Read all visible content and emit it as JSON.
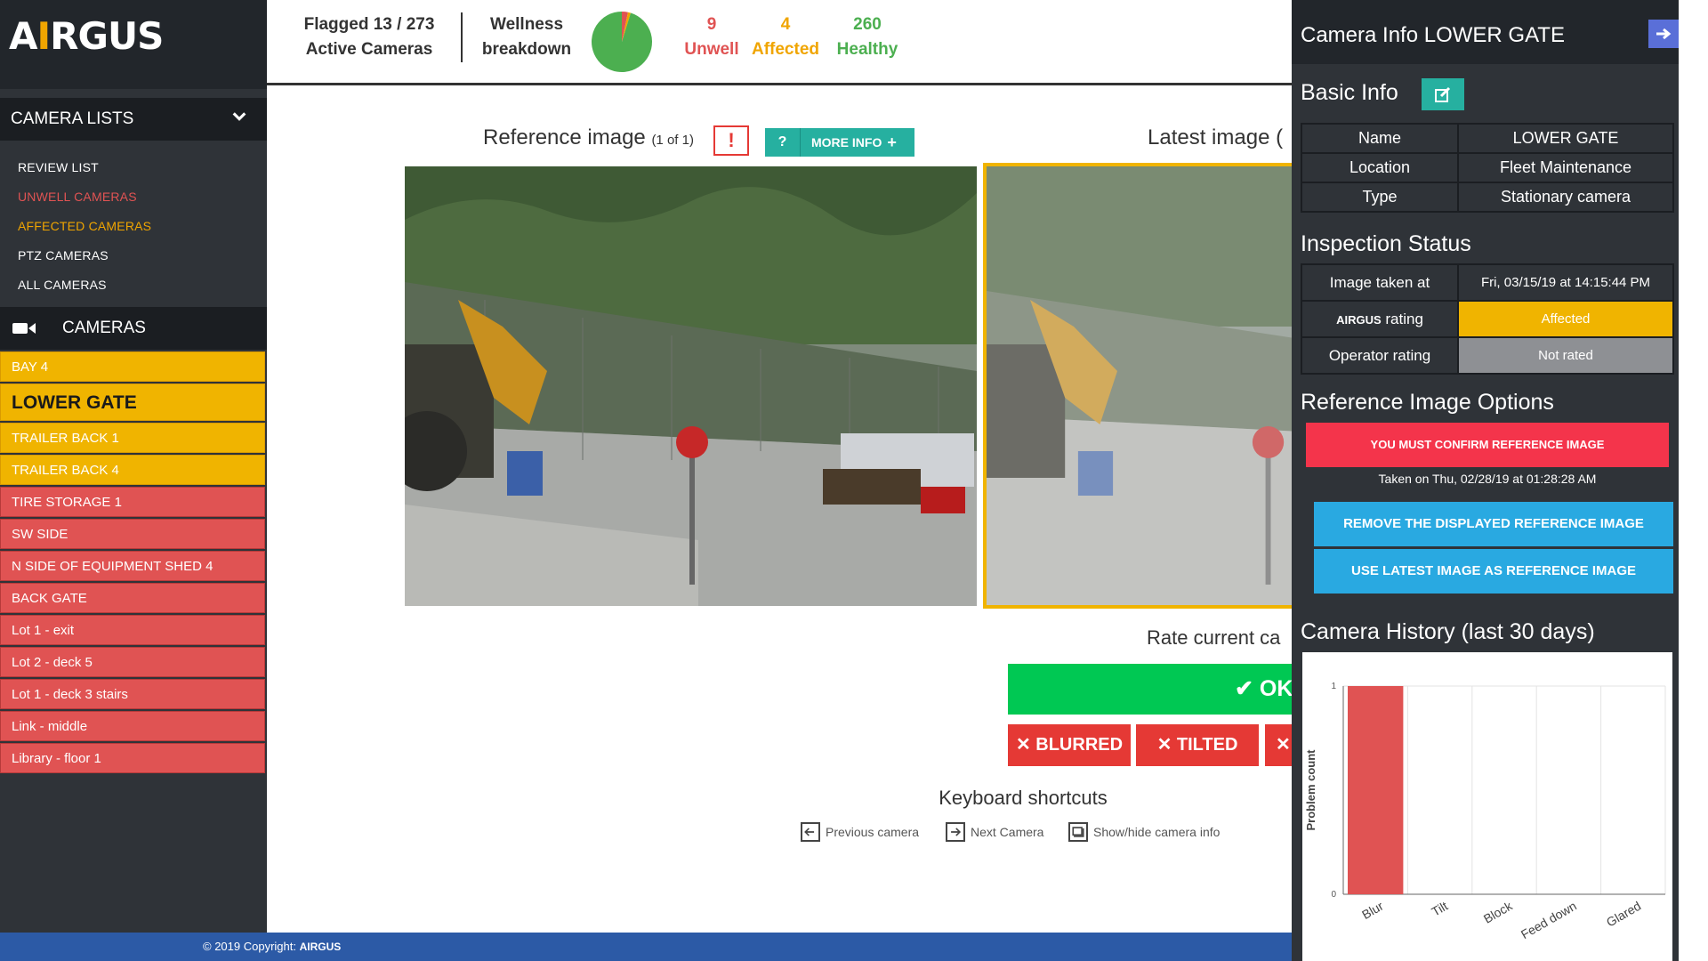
{
  "app": {
    "logo_text": "AIRGUS",
    "logo_before": "A",
    "logo_i": "I",
    "logo_after": "RGUS"
  },
  "sidebar": {
    "camera_lists_label": "CAMERA LISTS",
    "list_items": [
      {
        "label": "REVIEW LIST",
        "color": "#ffffff"
      },
      {
        "label": "UNWELL CAMERAS",
        "color": "#e05353"
      },
      {
        "label": "AFFECTED CAMERAS",
        "color": "#f0a500"
      },
      {
        "label": "PTZ CAMERAS",
        "color": "#ffffff"
      },
      {
        "label": "ALL CAMERAS",
        "color": "#ffffff"
      }
    ],
    "cameras_label": "CAMERAS",
    "cameras": [
      {
        "label": "BAY 4",
        "status": "affected"
      },
      {
        "label": "LOWER GATE",
        "status": "affected",
        "selected": true
      },
      {
        "label": "TRAILER BACK 1",
        "status": "affected"
      },
      {
        "label": "TRAILER BACK 4",
        "status": "affected"
      },
      {
        "label": "TIRE STORAGE 1",
        "status": "unwell"
      },
      {
        "label": "SW SIDE",
        "status": "unwell"
      },
      {
        "label": "N SIDE OF EQUIPMENT SHED 4",
        "status": "unwell"
      },
      {
        "label": "BACK GATE",
        "status": "unwell"
      },
      {
        "label": "Lot 1 - exit",
        "status": "unwell"
      },
      {
        "label": "Lot 2 - deck 5",
        "status": "unwell"
      },
      {
        "label": "Lot 1 - deck 3 stairs",
        "status": "unwell"
      },
      {
        "label": "Link - middle",
        "status": "unwell"
      },
      {
        "label": "Library - floor 1",
        "status": "unwell"
      }
    ]
  },
  "stats": {
    "flagged_prefix": "Flagged ",
    "flagged_count": "13",
    "flagged_sep": " / ",
    "total_count": "273",
    "active_cameras_label": "Active Cameras",
    "wellness_line1": "Wellness",
    "wellness_line2": "breakdown",
    "unwell_count": "9",
    "unwell_label": "Unwell",
    "affected_count": "4",
    "affected_label": "Affected",
    "healthy_count": "260",
    "healthy_label": "Healthy",
    "colors": {
      "unwell": "#e05353",
      "affected": "#f0a500",
      "healthy": "#4caf50"
    }
  },
  "main": {
    "reference_title": "Reference image",
    "reference_counter": "(1 of 1)",
    "alert_symbol": "!",
    "more_info_q": "?",
    "more_info_label": "MORE INFO",
    "more_info_plus": "+",
    "latest_title": "Latest image (",
    "rate_label": "Rate current ca",
    "ok_label": "OK",
    "blurred_label": "BLURRED",
    "tilted_label": "TILTED",
    "cross_glyph": "✕",
    "shortcuts_title": "Keyboard shortcuts",
    "shortcut_prev": "Previous camera",
    "shortcut_next": "Next Camera",
    "shortcut_info": "Show/hide camera info"
  },
  "footer": {
    "text": "© 2019 Copyright: ",
    "logo": "AIRGUS"
  },
  "panel": {
    "title": "Camera Info LOWER GATE",
    "basic_info_title": "Basic Info",
    "basic_rows": [
      {
        "key": "Name",
        "value": "LOWER GATE"
      },
      {
        "key": "Location",
        "value": "Fleet Maintenance"
      },
      {
        "key": "Type",
        "value": "Stationary camera"
      }
    ],
    "inspection_title": "Inspection Status",
    "image_taken_label": "Image taken at",
    "image_taken_value": "Fri, 03/15/19 at 14:15:44 PM",
    "airgus_rating_logo": "AIRGUS",
    "airgus_rating_label": " rating",
    "airgus_rating_value": "Affected",
    "operator_rating_label": "Operator rating",
    "operator_rating_value": "Not rated",
    "ref_options_title": "Reference Image Options",
    "confirm_banner": "YOU MUST CONFIRM REFERENCE IMAGE",
    "taken_on": "Taken on Thu, 02/28/19 at 01:28:28 AM",
    "remove_ref_label": "REMOVE THE DISPLAYED REFERENCE IMAGE",
    "use_latest_label": "USE LATEST IMAGE AS REFERENCE IMAGE",
    "history_title": "Camera History (last 30 days)"
  },
  "chart_data": {
    "type": "bar",
    "categories": [
      "Blur",
      "Tilt",
      "Block",
      "Feed down",
      "Glared"
    ],
    "values": [
      1,
      0,
      0,
      0,
      0
    ],
    "ylabel": "Problem count",
    "xlabel": "",
    "ylim": [
      0,
      1
    ],
    "yticks": [
      "0",
      "1"
    ],
    "bar_color": "#e05353",
    "grid": true
  }
}
